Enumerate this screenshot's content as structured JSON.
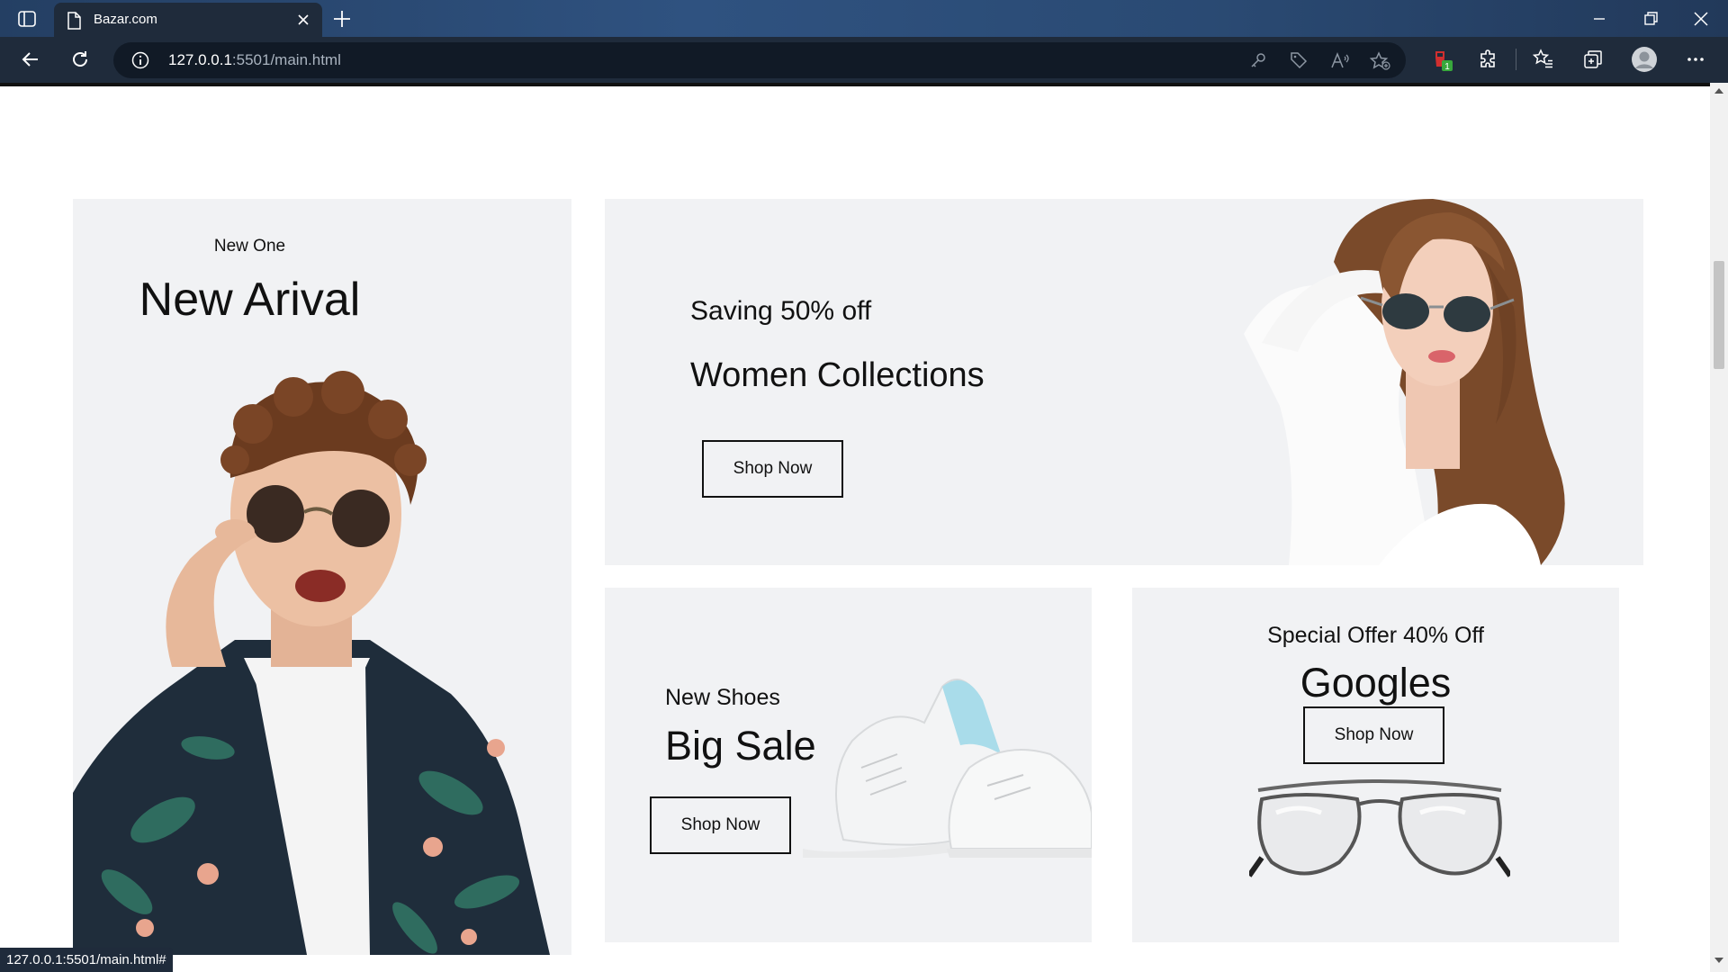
{
  "browser": {
    "tab_title": "Bazar.com",
    "url_host": "127.0.0.1",
    "url_rest": ":5501/main.html",
    "extension_badge": "1",
    "status_url": "127.0.0.1:5501/main.html#"
  },
  "promos": {
    "arrival": {
      "kicker": "New One",
      "title": "New Arival"
    },
    "women": {
      "kicker": "Saving 50% off",
      "title": "Women Collections",
      "button": "Shop Now"
    },
    "shoes": {
      "kicker": "New Shoes",
      "title": "Big Sale",
      "button": "Shop Now"
    },
    "goggles": {
      "kicker": "Special Offer 40% Off",
      "title": "Googles",
      "button": "Shop Now"
    }
  },
  "icons": [
    "sidebar-toggle-icon",
    "page-icon",
    "close-icon",
    "plus-icon",
    "minimize-icon",
    "restore-icon",
    "back-icon",
    "refresh-icon",
    "info-icon",
    "key-icon",
    "tag-icon",
    "read-aloud-icon",
    "star-add-icon",
    "extension-badge-icon",
    "puzzle-icon",
    "favorites-icon",
    "collections-icon",
    "avatar",
    "more-icon"
  ]
}
